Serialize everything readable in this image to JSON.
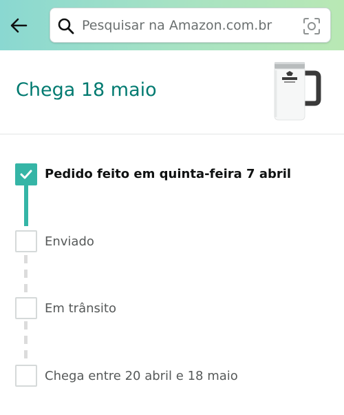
{
  "header": {
    "back_icon": "arrow-left-icon",
    "search": {
      "placeholder": "Pesquisar na Amazon.com.br",
      "value": "",
      "search_icon": "search-icon",
      "camera_icon": "camera-scan-icon"
    }
  },
  "delivery": {
    "arrival_text": "Chega 18 maio",
    "product_image": "stanley-beer-stein-white"
  },
  "tracker": {
    "steps": [
      {
        "label": "Pedido feito em quinta-feira 7 abril",
        "completed": true
      },
      {
        "label": "Enviado",
        "completed": false
      },
      {
        "label": "Em trânsito",
        "completed": false
      },
      {
        "label": "Chega entre 20 abril e 18 maio",
        "completed": false
      }
    ]
  },
  "colors": {
    "accent": "#007a70",
    "progress": "#35b5a6",
    "header_gradient_start": "#8ad8d1",
    "header_gradient_end": "#b9e8b4"
  }
}
